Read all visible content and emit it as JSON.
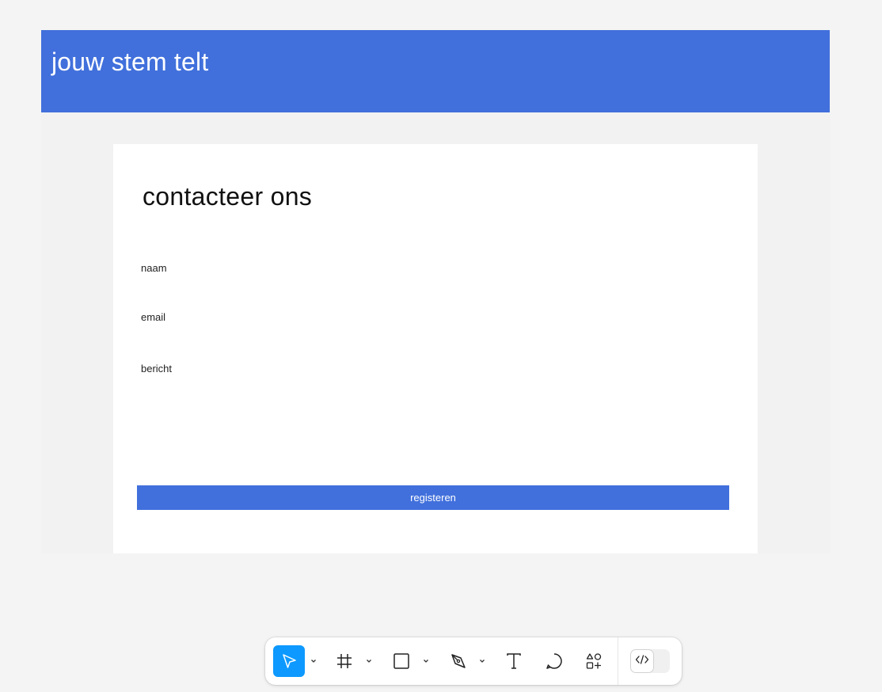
{
  "site": {
    "title": "jouw stem telt"
  },
  "form": {
    "title": "contacteer ons",
    "fields": [
      {
        "label": "naam"
      },
      {
        "label": "email"
      },
      {
        "label": "bericht"
      }
    ],
    "submit_label": "registeren"
  },
  "toolbar": {
    "tools": [
      {
        "name": "move",
        "icon": "cursor-icon",
        "active": true,
        "has_menu": true
      },
      {
        "name": "frame",
        "icon": "frame-icon",
        "active": false,
        "has_menu": true
      },
      {
        "name": "shape",
        "icon": "rectangle-icon",
        "active": false,
        "has_menu": true
      },
      {
        "name": "pen",
        "icon": "pen-icon",
        "active": false,
        "has_menu": true
      },
      {
        "name": "text",
        "icon": "text-icon",
        "active": false,
        "has_menu": false
      },
      {
        "name": "comment",
        "icon": "comment-icon",
        "active": false,
        "has_menu": false
      },
      {
        "name": "actions",
        "icon": "actions-icon",
        "active": false,
        "has_menu": false
      }
    ],
    "dev_mode": {
      "icon": "code-icon",
      "enabled": false
    }
  },
  "colors": {
    "brand": "#4170dc",
    "active_tool": "#0d99ff",
    "canvas": "#f4f4f4",
    "frame_bg": "#f2f2f2",
    "card_bg": "#ffffff"
  }
}
